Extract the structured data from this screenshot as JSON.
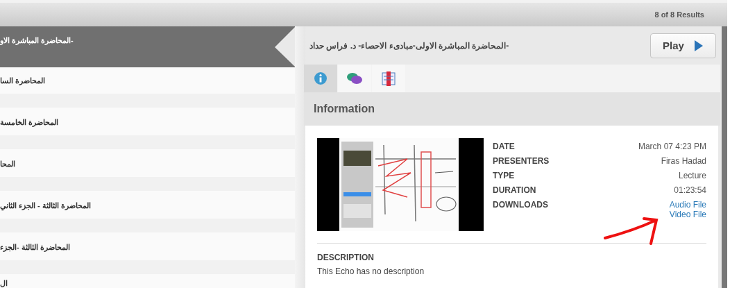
{
  "header": {
    "results": "8 of 8 Results"
  },
  "lectures": [
    {
      "title": "-المحاضرة المباشرة الاو",
      "selected": true
    },
    {
      "title": "المحاضرة السا",
      "selected": false
    },
    {
      "title": "المحاضرة الخامسة",
      "selected": false
    },
    {
      "title": "المحا",
      "selected": false
    },
    {
      "title": "المحاضرة الثالثة - الجزء الثاني",
      "selected": false
    },
    {
      "title": "المحاضرة الثالثة -الجزء",
      "selected": false
    },
    {
      "title": "ال",
      "selected": false
    }
  ],
  "recording": {
    "title": "-المحاضرة المباشرة الاولى-مبادىء الاحصاء- د. فراس حداد",
    "play": "Play"
  },
  "tabs": [
    {
      "kind": "info",
      "selected": true
    },
    {
      "kind": "chat",
      "selected": false
    },
    {
      "kind": "book",
      "selected": false
    }
  ],
  "panel": {
    "heading": "Information",
    "details": [
      {
        "label": "DATE",
        "value": "March 07 4:23 PM"
      },
      {
        "label": "PRESENTERS",
        "value": "Firas Hadad"
      },
      {
        "label": "TYPE",
        "value": "Lecture"
      },
      {
        "label": "DURATION",
        "value": "01:23:54"
      },
      {
        "label": "DOWNLOADS",
        "links": [
          "Audio File",
          "Video File"
        ]
      }
    ],
    "description_label": "DESCRIPTION",
    "description": "This Echo has no description"
  }
}
